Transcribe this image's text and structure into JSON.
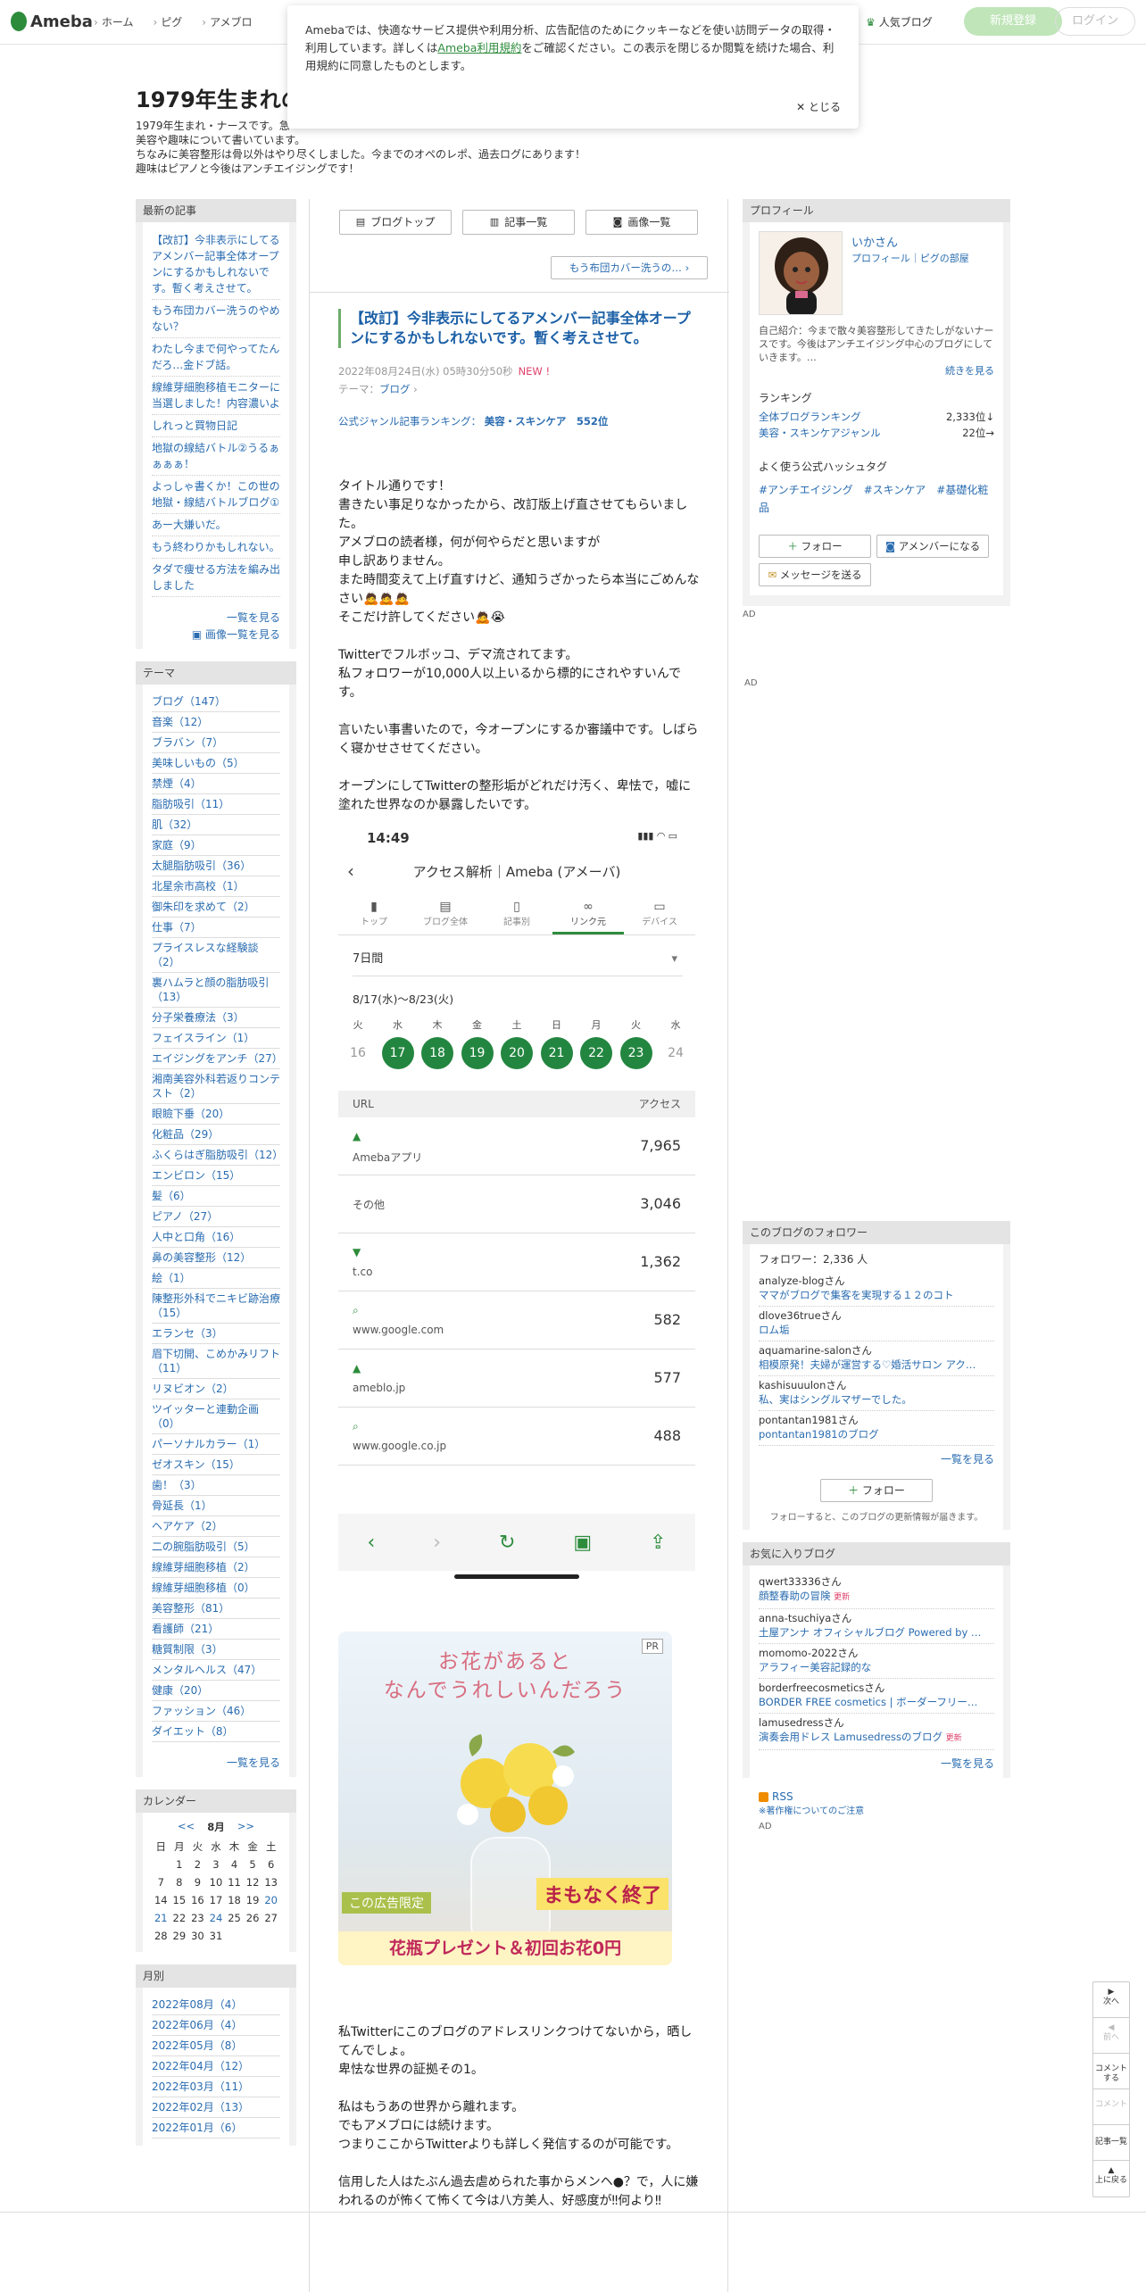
{
  "header": {
    "logo": "Ameba",
    "nav": [
      "ホーム",
      "ピグ",
      "アメブロ"
    ],
    "popular": "人気ブログ",
    "signup": "新規登録",
    "login": "ログイン"
  },
  "cookie": {
    "text1": "Amebaでは、快適なサービス提供や利用分析、広告配信のためにクッキーなどを使い訪問データの取得・利用しています。詳しくは",
    "link": "Ameba利用規約",
    "text2": "をご確認ください。この表示を閉じるか閲覧を続けた場合、利用規約に同意したものとします。",
    "close": "とじる"
  },
  "blog": {
    "title": "1979年生まれの",
    "desc": [
      "1979年生まれ・ナースです。急",
      "美容や趣味について書いています。",
      "ちなみに美容整形は骨以外はやり尽くしました。今までのオペのレポ、過去ログにあります！",
      "趣味はピアノと今後はアンチエイジングです！"
    ]
  },
  "recent": {
    "heading": "最新の記事",
    "items": [
      "【改訂】今非表示にしてるアメンバー記事全体オープンにするかもしれないです。暫く考えさせて。",
      "もう布団カバー洗うのやめない？",
      "わたし今まで何やってたんだろ…金ドブ話。",
      "線維芽細胞移植モニターに当選しました！内容濃いよ",
      "しれっと買物日記",
      "地獄の線結バトル②うるぁぁぁぁ！",
      "よっしゃ書くか！この世の地獄・線結バトルブログ①",
      "あー大嫌いだ。",
      "もう終わりかもしれない。",
      "タダで痩せる方法を編み出しました"
    ],
    "more": "一覧を見る",
    "images": "画像一覧を見る"
  },
  "themes": {
    "heading": "テーマ",
    "items": [
      "ブログ（147）",
      "音楽（12）",
      "ブラバン（7）",
      "美味しいもの（5）",
      "禁煙（4）",
      "脂肪吸引（11）",
      "肌（32）",
      "家庭（9）",
      "太腿脂肪吸引（36）",
      "北星余市高校（1）",
      "御朱印を求めて（2）",
      "仕事（7）",
      "プライスレスな経験談（2）",
      "裏ハムラと顔の脂肪吸引（13）",
      "分子栄養療法（3）",
      "フェイスライン（1）",
      "エイジングをアンチ（27）",
      "湘南美容外科若返りコンテスト（2）",
      "眼瞼下垂（20）",
      "化粧品（29）",
      "ふくらはぎ脂肪吸引（12）",
      "エンビロン（15）",
      "髪（6）",
      "ピアノ（27）",
      "人中と口角（16）",
      "鼻の美容整形（12）",
      "絵（1）",
      "陳整形外科でニキビ跡治療（15）",
      "エランセ（3）",
      "眉下切開、こめかみリフト（11）",
      "リヌビオン（2）",
      "ツイッターと連動企画（0）",
      "パーソナルカラー（1）",
      "ゼオスキン（15）",
      "歯！（3）",
      "骨延長（1）",
      "ヘアケア（2）",
      "二の腕脂肪吸引（5）",
      "線維芽細胞移植（2）",
      "線維芽細胞移植（0）",
      "美容整形（81）",
      "看護師（21）",
      "糖質制限（3）",
      "メンタルヘルス（47）",
      "健康（20）",
      "ファッション（46）",
      "ダイエット（8）"
    ],
    "more": "一覧を見る"
  },
  "calendar": {
    "heading": "カレンダー",
    "prev": "<<",
    "month": "8月",
    "next": ">>",
    "dow": [
      "日",
      "月",
      "火",
      "水",
      "木",
      "金",
      "土"
    ],
    "weeks": [
      [
        "",
        "1",
        "2",
        "3",
        "4",
        "5",
        "6"
      ],
      [
        "7",
        "8",
        "9",
        "10",
        "11",
        "12",
        "13"
      ],
      [
        "14",
        "15",
        "16",
        "17",
        "18",
        "19",
        "20"
      ],
      [
        "21",
        "22",
        "23",
        "24",
        "25",
        "26",
        "27"
      ],
      [
        "28",
        "29",
        "30",
        "31",
        "",
        "",
        ""
      ]
    ]
  },
  "months": {
    "heading": "月別",
    "items": [
      "2022年08月（4）",
      "2022年06月（4）",
      "2022年05月（8）",
      "2022年04月（12）",
      "2022年03月（11）",
      "2022年02月（13）",
      "2022年01月（6）"
    ]
  },
  "main": {
    "tabs": [
      "ブログトップ",
      "記事一覧",
      "画像一覧"
    ],
    "next": "もう布団カバー洗うの…",
    "title": "【改訂】今非表示にしてるアメンバー記事全体オープンにするかもしれないです。暫く考えさせて。",
    "date": "2022年08月24日(水) 05時30分50秒",
    "new": "NEW !",
    "theme_label": "テーマ：",
    "theme": "ブログ",
    "rank_label": "公式ジャンル記事ランキング：",
    "rank_genre": "美容・スキンケア",
    "rank_num": "552位",
    "body": [
      "タイトル通りです！\n書きたい事足りなかったから、改訂版上げ直させてもらいました。\nアメブロの読者様，何が何やらだと思いますが\n申し訳ありません。\nまた時間変えて上げ直すけど、通知うざかったら本当にごめんなさい🙇🙇🙇\nそこだけ許してください🙇😭",
      "Twitterでフルボッコ、デマ流されてます。\n私フォロワーが10,000人以上いるから標的にされやすいんです。",
      "言いたい事書いたので，今オープンにするか審議中です。しばらく寝かせさせてください。",
      "オープンにしてTwitterの整形垢がどれだけ汚く、卑怯で，嘘に塗れた世界なのか暴露したいです。"
    ],
    "body2": [
      "私Twitterにこのブログのアドレスリンクつけてないから，晒してんでしょ。\n卑怯な世界の証拠その1。",
      "私はもうあの世界から離れます。\nでもアメブロには続けます。\nつまりここからTwitterよりも詳しく発信するのが可能です。",
      "信用した人はたぶん過去虐められた事からメンヘ●？で，人に嫌われるのが怖くて怖くて今は八方美人、好感度が‼何より‼"
    ]
  },
  "shot": {
    "time": "14:49",
    "title": "アクセス解析｜Ameba (アメーバ)",
    "tabs": [
      "トップ",
      "ブログ全体",
      "記事別",
      "リンク元",
      "デバイス"
    ],
    "range": "7日間",
    "dates": "8/17(水)〜8/23(火)",
    "days": [
      {
        "w": "火",
        "n": "16"
      },
      {
        "w": "水",
        "n": "17"
      },
      {
        "w": "木",
        "n": "18"
      },
      {
        "w": "金",
        "n": "19"
      },
      {
        "w": "土",
        "n": "20"
      },
      {
        "w": "日",
        "n": "21"
      },
      {
        "w": "月",
        "n": "22"
      },
      {
        "w": "火",
        "n": "23"
      },
      {
        "w": "水",
        "n": "24"
      }
    ],
    "col_url": "URL",
    "col_access": "アクセス",
    "rows": [
      {
        "src": "Amebaアプリ",
        "val": "7,965"
      },
      {
        "src": "その他",
        "val": "3,046"
      },
      {
        "src": "t.co",
        "val": "1,362"
      },
      {
        "src": "www.google.com",
        "val": "582"
      },
      {
        "src": "ameblo.jp",
        "val": "577"
      },
      {
        "src": "www.google.co.jp",
        "val": "488"
      }
    ]
  },
  "ad": {
    "line1": "お花があると",
    "line2": "なんでうれしいんだろう",
    "pr": "PR",
    "limited": "この広告限定",
    "ending": "まもなく終了",
    "gift": "花瓶プレゼント＆初回お花0円"
  },
  "profile": {
    "heading": "プロフィール",
    "name": "いかさん",
    "links": "プロフィール｜ピグの部屋",
    "intro": "自己紹介：今まで散々美容整形してきたしがないナースです。今後はアンチエイジング中心のブログにしていきます。…",
    "intro_more": "続きを見る",
    "rank_h": "ランキング",
    "rank1": "全体ブログランキング",
    "rank1v": "2,333位↓",
    "rank2": "美容・スキンケアジャンル",
    "rank2v": "22位→",
    "tags_h": "よく使う公式ハッシュタグ",
    "tags": "#アンチエイジング　#スキンケア　#基礎化粧品",
    "follow": "フォロー",
    "amember": "アメンバーになる",
    "message": "メッセージを送る",
    "ad": "AD"
  },
  "follow": {
    "heading": "このブログのフォロワー",
    "count": "フォロワー：2,336 人",
    "items": [
      {
        "u": "analyze-blogさん",
        "b": "ママがブログで集客を実現する１２のコト"
      },
      {
        "u": "dlove36trueさん",
        "b": "ロム垢"
      },
      {
        "u": "aquamarine-salonさん",
        "b": "相模原発！夫婦が運営する♡婚活サロン アク…"
      },
      {
        "u": "kashisuuulonさん",
        "b": "私、実はシングルマザーでした。"
      },
      {
        "u": "pontantan1981さん",
        "b": "pontantan1981のブログ"
      }
    ],
    "more": "一覧を見る",
    "btn": "フォロー",
    "note": "フォローすると、このブログの更新情報が届きます。"
  },
  "favs": {
    "heading": "お気に入りブログ",
    "items": [
      {
        "u": "qwert33336さん",
        "b": "顔整春助の冒険",
        "upd": "更新"
      },
      {
        "u": "anna-tsuchiyaさん",
        "b": "土屋アンナ オフィシャルブログ Powered by …",
        "upd": ""
      },
      {
        "u": "momomo-2022さん",
        "b": "アラフィー美容記録的な",
        "upd": ""
      },
      {
        "u": "borderfreecosmeticsさん",
        "b": "BORDER FREE cosmetics | ボーダーフリー…",
        "upd": ""
      },
      {
        "u": "lamusedressさん",
        "b": "演奏会用ドレス Lamusedressのブログ",
        "upd": "更新"
      }
    ],
    "more": "一覧を見る",
    "rss": "RSS",
    "copyright": "※著作権についてのご注意",
    "ad": "AD"
  },
  "sidenav": [
    "次へ",
    "前へ",
    "コメントする",
    "コメント",
    "記事一覧",
    "上に戻る"
  ],
  "ad_label": "AD"
}
